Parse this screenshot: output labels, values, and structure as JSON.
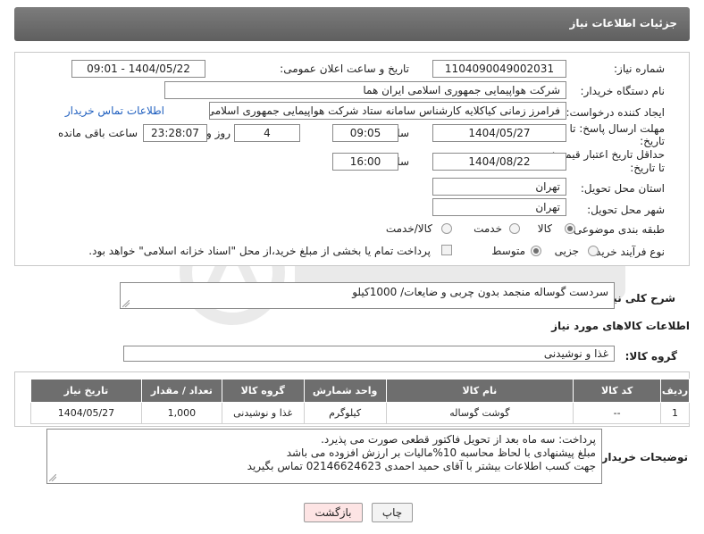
{
  "header": {
    "title": "جزئیات اطلاعات نیاز"
  },
  "form": {
    "need_number_label": "شماره نیاز:",
    "need_number": "1104090049002031",
    "announce_label": "تاریخ و ساعت اعلان عمومی:",
    "announce_value": "1404/05/22 - 09:01",
    "buyer_org_label": "نام دستگاه خریدار:",
    "buyer_org": "شرکت هواپیمایی جمهوری اسلامی ایران هما",
    "requester_label": "ایجاد کننده درخواست:",
    "requester": "فرامرز زمانی کیاکلایه کارشناس سامانه ستاد شرکت هواپیمایی جمهوری اسلامی",
    "buyer_contact_link": "اطلاعات تماس خریدار",
    "deadline_label_1": "مهلت ارسال پاسخ: تا",
    "deadline_label_2": "تاریخ:",
    "deadline_date": "1404/05/27",
    "time_label": "ساعت",
    "deadline_time": "09:05",
    "days_value": "4",
    "days_label": "روز و",
    "remaining_time": "23:28:07",
    "remaining_label": "ساعت باقی مانده",
    "min_price_label_1": "حداقل تاریخ اعتبار قیمت:",
    "min_price_label_2": "تا تاریخ:",
    "price_date": "1404/08/22",
    "price_time": "16:00",
    "province_label": "استان محل تحویل:",
    "province": "تهران",
    "city_label": "شهر محل تحویل:",
    "city": "تهران",
    "category_label": "طبقه بندی موضوعی:",
    "category_options": [
      "کالا",
      "خدمت",
      "کالا/خدمت"
    ],
    "purchase_type_label": "نوع فرآیند خرید :",
    "purchase_options": [
      "جزیی",
      "متوسط"
    ],
    "payment_note": "پرداخت تمام یا بخشی از مبلغ خرید،از محل \"اسناد خزانه اسلامی\" خواهد بود."
  },
  "description": {
    "label": "شرح کلی نیاز:",
    "text": "سردست گوساله منجمد بدون چربی و ضایعات/ 1000کیلو"
  },
  "goods": {
    "section_title": "اطلاعات کالاهای مورد نیاز",
    "group_label": "گروه کالا:",
    "group_value": "غذا و نوشیدنی",
    "columns": [
      "ردیف",
      "کد کالا",
      "نام کالا",
      "واحد شمارش",
      "گروه کالا",
      "تعداد / مقدار",
      "تاریخ نیاز"
    ],
    "rows": [
      [
        "1",
        "--",
        "گوشت گوساله",
        "کیلوگرم",
        "غذا و نوشیدنی",
        "1,000",
        "1404/05/27"
      ]
    ]
  },
  "buyer_notes": {
    "label": "توضیحات خریدار:",
    "lines": [
      "پرداخت: سه ماه بعد از تحویل فاکتور قطعی صورت می پذیرد.",
      "مبلغ پیشنهادی با لحاظ محاسبه 10%مالیات بر ارزش افزوده می باشد",
      "جهت کسب اطلاعات بیشتر با آقای حمید احمدی 02146624623 تماس بگیرید"
    ]
  },
  "buttons": {
    "print": "چاپ",
    "back": "بازگشت"
  },
  "colors": {
    "header_bg": "#6b6b6b",
    "link": "#1f5fbf",
    "back_button_bg": "#fde4e4"
  }
}
